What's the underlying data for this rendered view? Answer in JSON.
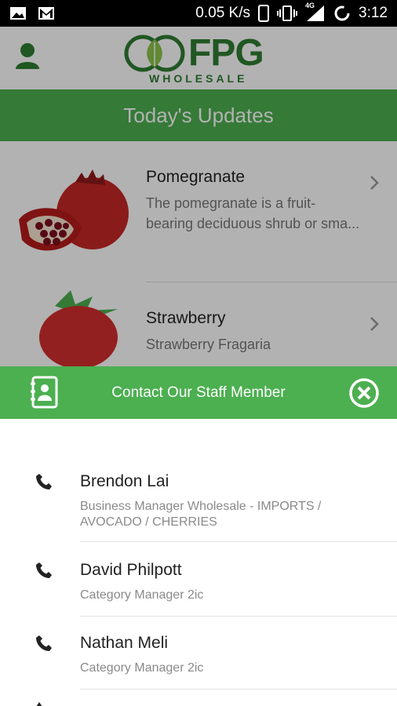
{
  "status_bar": {
    "speed": "0.05 K/s",
    "network": "4G",
    "time": "3:12"
  },
  "header": {
    "logo_main": "FPG",
    "logo_sub": "WHOLESALE",
    "title": "Today's Updates"
  },
  "products": [
    {
      "name": "Pomegranate",
      "description_line1": "The pomegranate is a fruit-",
      "description_line2": "bearing deciduous shrub or sma..."
    },
    {
      "name": "Strawberry",
      "description_line1": "Strawberry Fragaria",
      "description_line2": ""
    }
  ],
  "sheet": {
    "title": "Contact Our Staff Member"
  },
  "staff": [
    {
      "name": "Brendon Lai",
      "role": "Business Manager Wholesale - IMPORTS / AVOCADO / CHERRIES"
    },
    {
      "name": "David Philpott",
      "role": "Category Manager 2ic"
    },
    {
      "name": "Nathan Meli",
      "role": "Category Manager 2ic"
    }
  ],
  "colors": {
    "brand_green": "#4caf50",
    "logo_green": "#2e7d32"
  },
  "icons": [
    "image-icon",
    "gmail-icon",
    "phone-status-icon",
    "vibrate-icon",
    "signal-icon",
    "loading-icon",
    "user-icon",
    "chevron-right-icon",
    "contact-book-icon",
    "close-icon",
    "phone-icon"
  ]
}
